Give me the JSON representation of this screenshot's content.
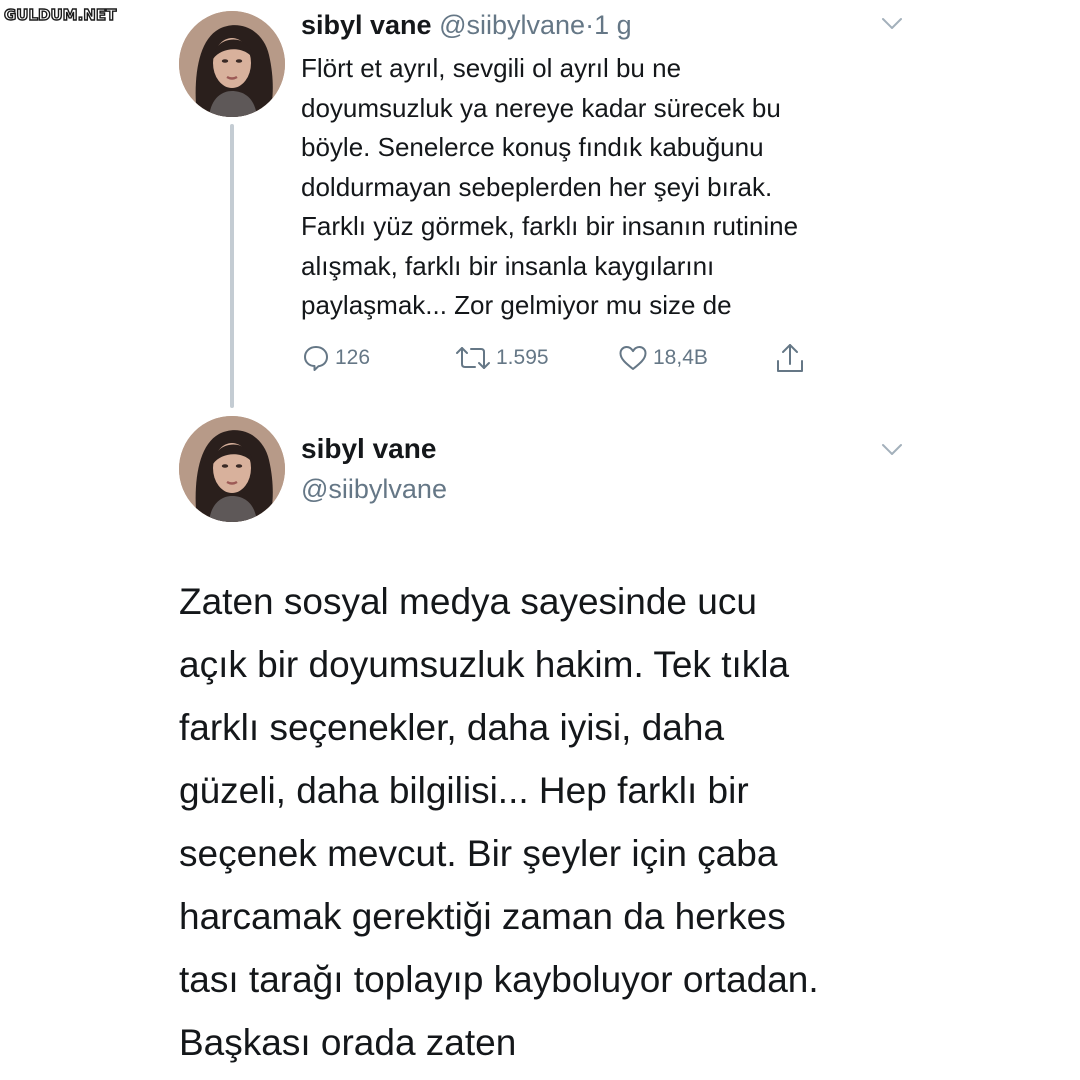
{
  "watermark": {
    "text": "GULDUM.NET"
  },
  "tweet1": {
    "author_name": "sibyl vane",
    "handle": "@siibylvane",
    "separator": "·",
    "time": "1 g",
    "text_lines": [
      "Flört et ayrıl, sevgili ol ayrıl bu ne",
      "doyumsuzluk ya nereye kadar sürecek bu",
      "böyle. Senelerce konuş fındık kabuğunu",
      "doldurmayan sebeplerden her şeyi bırak.",
      "Farklı yüz görmek, farklı bir insanın rutinine",
      "alışmak, farklı bir insanla kaygılarını",
      "paylaşmak... Zor gelmiyor mu size de"
    ],
    "actions": {
      "reply_count": "126",
      "retweet_count": "1.595",
      "like_count": "18,4B"
    },
    "icons": {
      "reply": "reply-icon",
      "retweet": "retweet-icon",
      "like": "heart-icon",
      "share": "share-icon",
      "menu": "chevron-down-icon"
    }
  },
  "tweet2": {
    "author_name": "sibyl vane",
    "handle": "@siibylvane",
    "text_lines": [
      "Zaten sosyal medya sayesinde ucu",
      "açık bir doyumsuzluk hakim. Tek tıkla",
      "farklı seçenekler, daha iyisi, daha",
      "güzeli, daha bilgilisi... Hep farklı bir",
      "seçenek mevcut. Bir şeyler için çaba",
      "harcamak gerektiği zaman da herkes",
      "tası tarağı toplayıp kayboluyor ortadan.",
      "Başkası orada zaten"
    ]
  },
  "colors": {
    "text": "#14171a",
    "muted": "#657786",
    "thread_line": "#c4ccd3",
    "background": "#ffffff"
  }
}
